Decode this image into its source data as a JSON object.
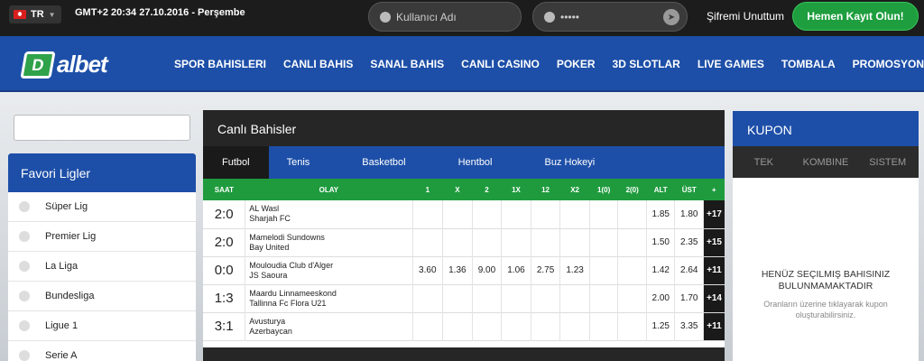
{
  "topbar": {
    "lang": "TR",
    "clock": "GMT+2 20:34 27.10.2016 - Perşembe",
    "username_placeholder": "Kullanıcı Adı",
    "password_mask": "•••••",
    "forgot": "Şifremi Unuttum",
    "register": "Hemen Kayıt Olun!"
  },
  "nav": {
    "logo": "albet",
    "logo_mark": "D",
    "items": [
      "SPOR BAHISLERI",
      "CANLI BAHIS",
      "SANAL BAHIS",
      "CANLI CASINO",
      "POKER",
      "3D SLOTLAR",
      "LIVE GAMES",
      "TOMBALA",
      "PROMOSYONLAR"
    ]
  },
  "favorites": {
    "title": "Favori Ligler",
    "leagues": [
      "Süper Lig",
      "Premier Lig",
      "La Liga",
      "Bundesliga",
      "Ligue 1",
      "Serie A"
    ]
  },
  "live": {
    "title": "Canlı Bahisler",
    "tabs": [
      "Futbol",
      "Tenis",
      "Basketbol",
      "Hentbol",
      "Buz Hokeyi"
    ],
    "headers": [
      "SAAT",
      "OLAY",
      "1",
      "X",
      "2",
      "1X",
      "12",
      "X2",
      "1(0)",
      "2(0)",
      "ALT",
      "ÜST",
      "+"
    ],
    "rows": [
      {
        "score": "2:0",
        "home": "AL Wasl",
        "away": "Sharjah FC",
        "o1": "",
        "ox": "",
        "o2": "",
        "o1x": "",
        "o12": "",
        "ox2": "",
        "h1": "",
        "h2": "",
        "alt": "1.85",
        "ust": "1.80",
        "more": "+17"
      },
      {
        "score": "2:0",
        "home": "Mamelodi Sundowns",
        "away": "Bay United",
        "o1": "",
        "ox": "",
        "o2": "",
        "o1x": "",
        "o12": "",
        "ox2": "",
        "h1": "",
        "h2": "",
        "alt": "1.50",
        "ust": "2.35",
        "more": "+15"
      },
      {
        "score": "0:0",
        "home": "Mouloudia Club d'Alger",
        "away": "JS Saoura",
        "o1": "3.60",
        "ox": "1.36",
        "o2": "9.00",
        "o1x": "1.06",
        "o12": "2.75",
        "ox2": "1.23",
        "h1": "",
        "h2": "",
        "alt": "1.42",
        "ust": "2.64",
        "more": "+11"
      },
      {
        "score": "1:3",
        "home": "Maardu Linnameeskond",
        "away": "Tallinna Fc Flora U21",
        "o1": "",
        "ox": "",
        "o2": "",
        "o1x": "",
        "o12": "",
        "ox2": "",
        "h1": "",
        "h2": "",
        "alt": "2.00",
        "ust": "1.70",
        "more": "+14"
      },
      {
        "score": "3:1",
        "home": "Avusturya",
        "away": "Azerbaycan",
        "o1": "",
        "ox": "",
        "o2": "",
        "o1x": "",
        "o12": "",
        "ox2": "",
        "h1": "",
        "h2": "",
        "alt": "1.25",
        "ust": "3.35",
        "more": "+11"
      }
    ]
  },
  "kupon": {
    "title": "KUPON",
    "tabs": [
      "TEK",
      "KOMBINE",
      "SISTEM"
    ],
    "empty_title_1": "HENÜZ SEÇILMIŞ BAHISINIZ",
    "empty_title_2": "BULUNMAMAKTADIR",
    "empty_sub_1": "Oranların üzerine tıklayarak kupon",
    "empty_sub_2": "oluşturabilirsiniz."
  },
  "colors": {
    "primary": "#1d4fa8",
    "accent_green": "#1f9b3e",
    "dark": "#262626"
  }
}
